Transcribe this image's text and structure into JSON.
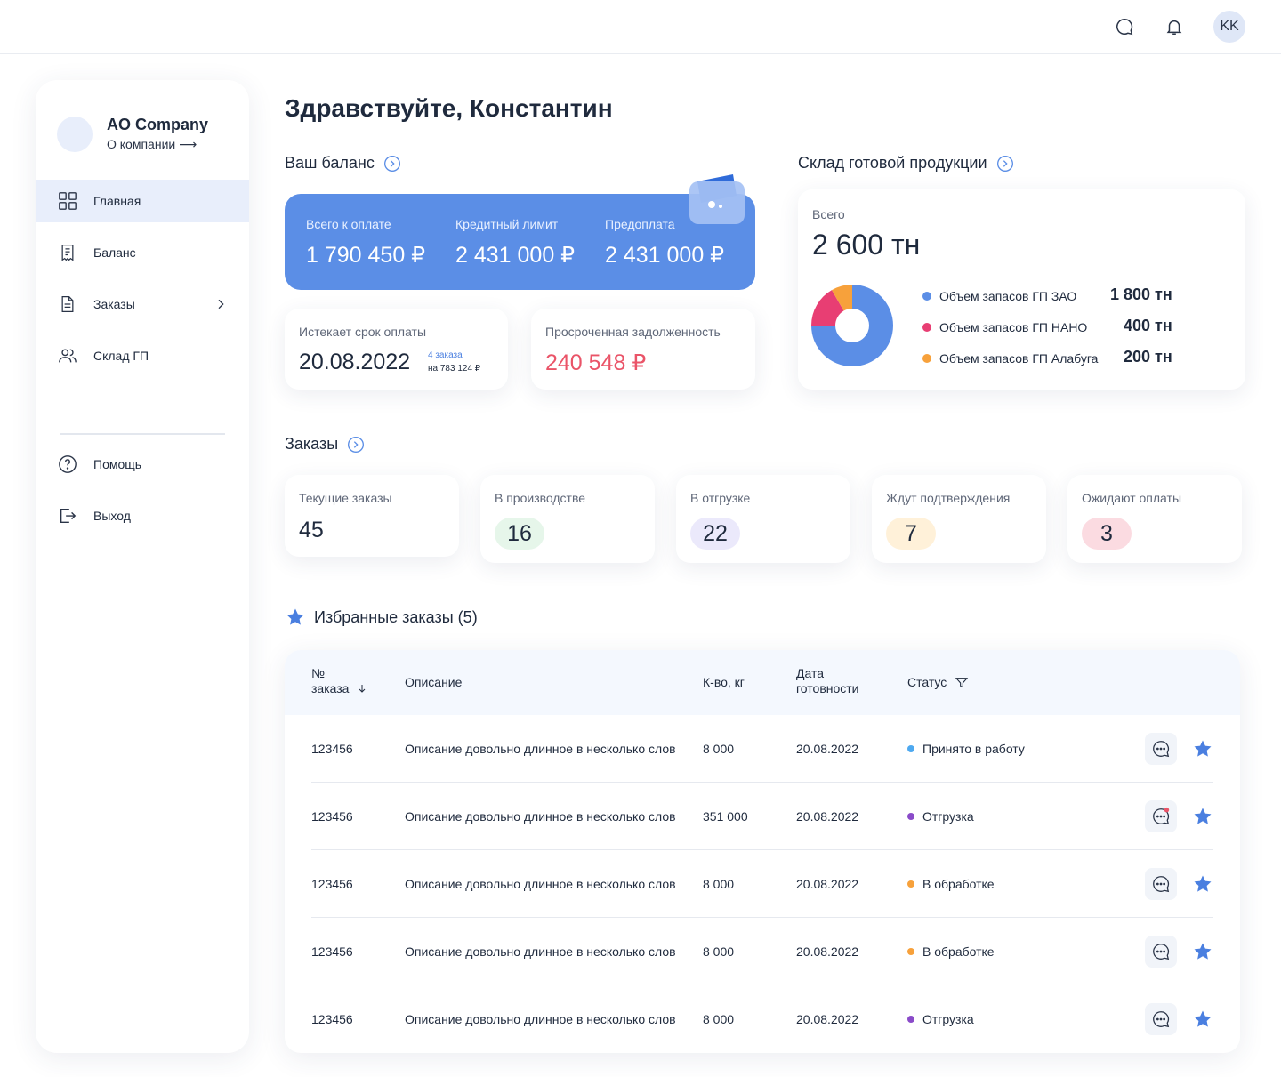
{
  "header": {
    "avatar_initials": "KK",
    "icons": [
      "chat-icon",
      "bell-icon"
    ]
  },
  "sidebar": {
    "company_name": "AO Company",
    "company_link": "О компании",
    "nav": [
      {
        "label": "Главная",
        "icon": "dashboard-icon",
        "active": true
      },
      {
        "label": "Баланс",
        "icon": "receipt-icon"
      },
      {
        "label": "Заказы",
        "icon": "document-icon",
        "has_submenu": true
      },
      {
        "label": "Склад ГП",
        "icon": "users-icon"
      }
    ],
    "bottom_nav": [
      {
        "label": "Помощь",
        "icon": "help-icon"
      },
      {
        "label": "Выход",
        "icon": "logout-icon"
      }
    ]
  },
  "main": {
    "greeting": "Здравствуйте, Константин",
    "balance": {
      "title": "Ваш баланс",
      "items": [
        {
          "label": "Всего к оплате",
          "value": "1 790 450 ₽"
        },
        {
          "label": "Кредитный лимит",
          "value": "2 431 000 ₽"
        },
        {
          "label": "Предоплата",
          "value": "2 431 000 ₽"
        }
      ],
      "due": {
        "label": "Истекает срок оплаты",
        "date": "20.08.2022",
        "orders_link": "4 заказа",
        "orders_sum": "на 783 124 ₽"
      },
      "overdue": {
        "label": "Просроченная задолженность",
        "value": "240 548 ₽"
      }
    },
    "warehouse": {
      "title": "Склад готовой продукции",
      "total_label": "Всего",
      "total_value": "2 600 тн",
      "legend": [
        {
          "label": "Объем запасов ГП ЗАО",
          "value": "1 800 тн",
          "amount": 1800,
          "color": "#5b8ee6"
        },
        {
          "label": "Объем запасов ГП НАНО",
          "value": "400 тн",
          "amount": 400,
          "color": "#e83e73"
        },
        {
          "label": "Объем запасов ГП Алабуга",
          "value": "200 тн",
          "amount": 200,
          "color": "#f7a13b"
        }
      ]
    },
    "orders": {
      "title": "Заказы",
      "cards": [
        {
          "label": "Текущие заказы",
          "value": "45"
        },
        {
          "label": "В производстве",
          "value": "16",
          "pill_color": "#e6f6ea"
        },
        {
          "label": "В отгрузке",
          "value": "22",
          "pill_color": "#ebe9fb"
        },
        {
          "label": "Ждут подтверждения",
          "value": "7",
          "pill_color": "#fff1d9"
        },
        {
          "label": "Ожидают оплаты",
          "value": "3",
          "pill_color": "#fbdbe1"
        }
      ]
    },
    "favorites": {
      "title": "Избранные заказы (5)",
      "columns": {
        "number_line1": "№",
        "number_line2": "заказа",
        "description": "Описание",
        "quantity": "К-во, кг",
        "date_line1": "Дата",
        "date_line2": "готовности",
        "status": "Статус"
      },
      "rows": [
        {
          "number": "123456",
          "description": "Описание довольно длинное в несколько слов",
          "quantity": "8 000",
          "date": "20.08.2022",
          "status": "Принято в работу",
          "status_color": "#4ea9f0",
          "unread": false
        },
        {
          "number": "123456",
          "description": "Описание довольно длинное в несколько слов",
          "quantity": "351 000",
          "date": "20.08.2022",
          "status": "Отгрузка",
          "status_color": "#8a4bc9",
          "unread": true
        },
        {
          "number": "123456",
          "description": "Описание довольно длинное в несколько слов",
          "quantity": "8 000",
          "date": "20.08.2022",
          "status": "В обработке",
          "status_color": "#f7a13b",
          "unread": false
        },
        {
          "number": "123456",
          "description": "Описание довольно длинное в несколько слов",
          "quantity": "8 000",
          "date": "20.08.2022",
          "status": "В обработке",
          "status_color": "#f7a13b",
          "unread": false
        },
        {
          "number": "123456",
          "description": "Описание довольно длинное в несколько слов",
          "quantity": "8 000",
          "date": "20.08.2022",
          "status": "Отгрузка",
          "status_color": "#8a4bc9",
          "unread": false
        }
      ]
    }
  },
  "colors": {
    "accent": "#5b8ee6",
    "active_nav_bg": "#e8eefb",
    "overdue_red": "#ea5468"
  }
}
